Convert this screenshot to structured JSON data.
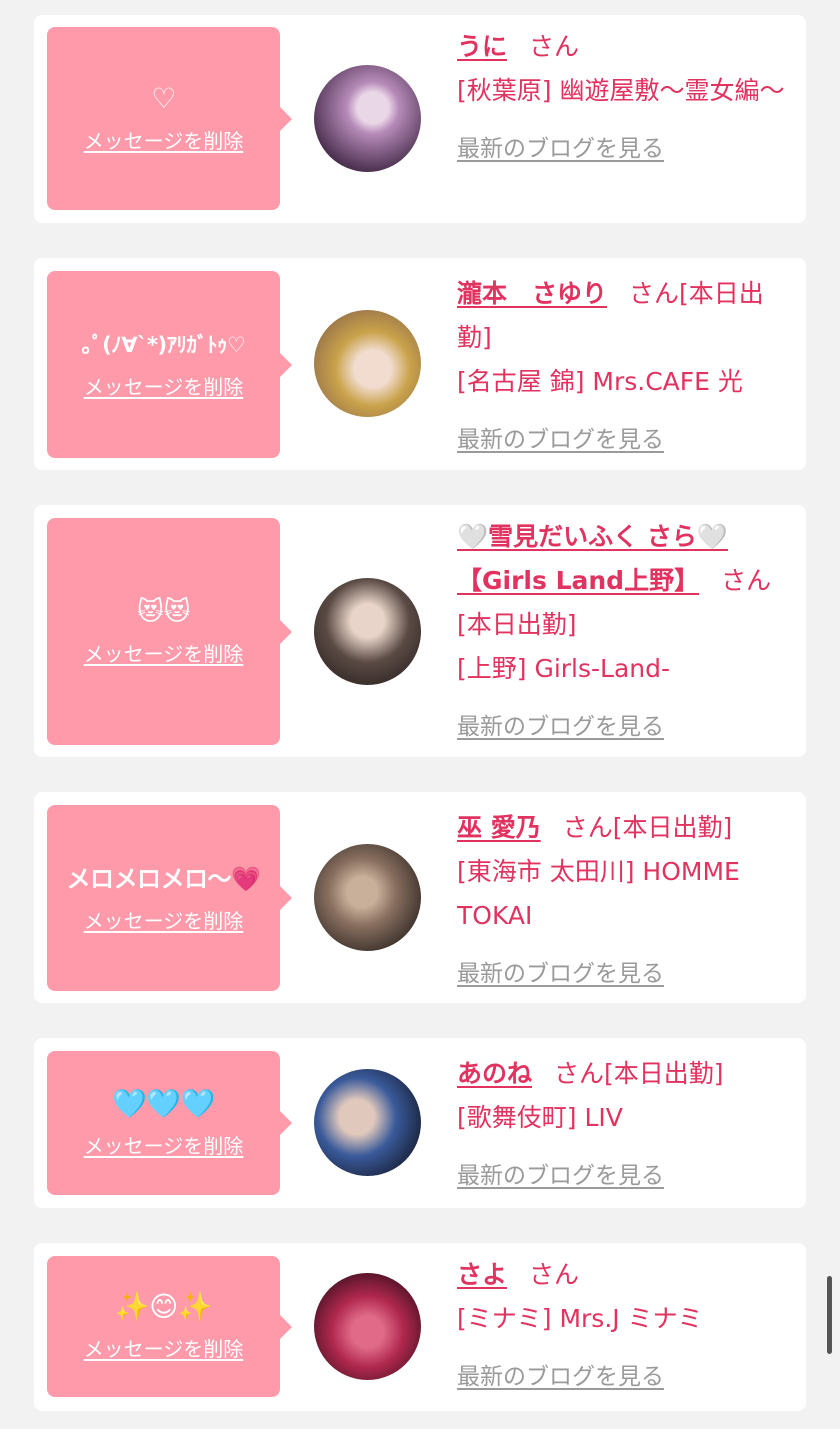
{
  "items": [
    {
      "message": "♡",
      "delete_label": "メッセージを削除",
      "name": "うに",
      "san": "さん",
      "status": "",
      "shop": "[秋葉原] 幽遊屋敷～霊女編～",
      "blog_label": "最新のブログを見る",
      "avatar_colors": [
        "#3b2340",
        "#b68ab8",
        "#e9d6e6"
      ]
    },
    {
      "message": "｡ﾟ(ﾉ∀`*)ｱﾘｶﾞﾄｩ♡",
      "delete_label": "メッセージを削除",
      "name": "瀧本　さゆり",
      "san": "さん",
      "status": "[本日出勤]",
      "shop": "[名古屋 錦] Mrs.CAFE 光",
      "blog_label": "最新のブログを見る",
      "avatar_colors": [
        "#c9a24a",
        "#e7c6b8",
        "#8e6a4a"
      ]
    },
    {
      "message": "😻😻",
      "delete_label": "メッセージを削除",
      "name": "🤍雪見だいふく さら🤍【Girls Land上野】",
      "san": "さん",
      "status": "[本日出勤]",
      "shop": "[上野] Girls-Land-",
      "blog_label": "最新のブログを見る",
      "avatar_colors": [
        "#5a4a44",
        "#d8c0b2",
        "#2b2220"
      ]
    },
    {
      "message": "メロメロメロ〜💗",
      "delete_label": "メッセージを削除",
      "name": "巫 愛乃",
      "san": "さん",
      "status": "[本日出勤]",
      "shop": "[東海市 太田川] HOMME TOKAI",
      "blog_label": "最新のブログを見る",
      "avatar_colors": [
        "#2a2320",
        "#8a7060",
        "#c9b09a"
      ]
    },
    {
      "message": "🩵🩵🩵",
      "delete_label": "メッセージを削除",
      "name": "あのね",
      "san": "さん",
      "status": "[本日出勤]",
      "shop": "[歌舞伎町] LIV",
      "blog_label": "最新のブログを見る",
      "avatar_colors": [
        "#141a2c",
        "#3a5a9a",
        "#e0c8bc"
      ]
    },
    {
      "message": "✨😊✨",
      "delete_label": "メッセージを削除",
      "name": "さよ",
      "san": "さん",
      "status": "",
      "shop": "[ミナミ] Mrs.J ミナミ",
      "blog_label": "最新のブログを見る",
      "avatar_colors": [
        "#3a0f1e",
        "#b0284e",
        "#e06a88"
      ]
    }
  ]
}
